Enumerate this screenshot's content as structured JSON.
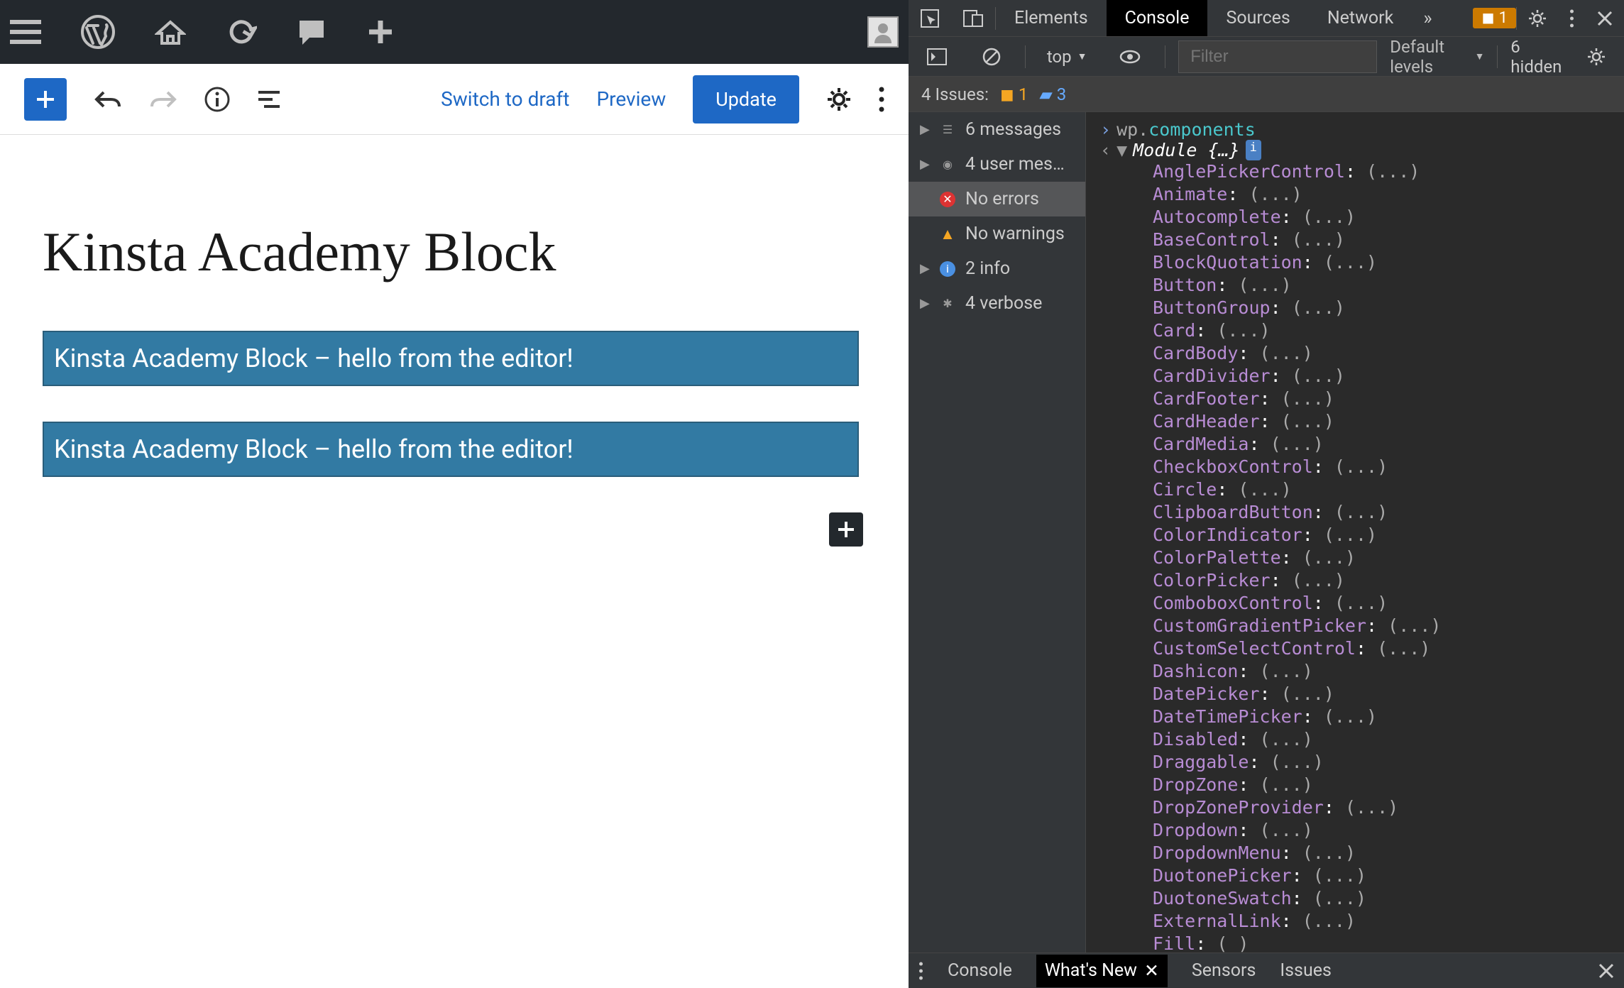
{
  "wp": {
    "avatar": "user"
  },
  "editor": {
    "switch_to_draft": "Switch to draft",
    "preview": "Preview",
    "update": "Update",
    "post_title": "Kinsta Academy Block",
    "block1": "Kinsta Academy Block – hello from the editor!",
    "block2": "Kinsta Academy Block – hello from the editor!"
  },
  "devtools": {
    "tabs": {
      "elements": "Elements",
      "console": "Console",
      "sources": "Sources",
      "network": "Network"
    },
    "issues_chip": "1",
    "ctx": "top",
    "filter_placeholder": "Filter",
    "levels": "Default levels",
    "hidden": "6 hidden",
    "issues_label": "4 Issues:",
    "issues_warn": "1",
    "issues_info": "3",
    "sidebar": {
      "messages": "6 messages",
      "user": "4 user mes…",
      "errors": "No errors",
      "warnings": "No warnings",
      "info": "2 info",
      "verbose": "4 verbose"
    },
    "console": {
      "input": "wp.components",
      "output_head": "Module {…}",
      "props": [
        "AnglePickerControl",
        "Animate",
        "Autocomplete",
        "BaseControl",
        "BlockQuotation",
        "Button",
        "ButtonGroup",
        "Card",
        "CardBody",
        "CardDivider",
        "CardFooter",
        "CardHeader",
        "CardMedia",
        "CheckboxControl",
        "Circle",
        "ClipboardButton",
        "ColorIndicator",
        "ColorPalette",
        "ColorPicker",
        "ComboboxControl",
        "CustomGradientPicker",
        "CustomSelectControl",
        "Dashicon",
        "DatePicker",
        "DateTimePicker",
        "Disabled",
        "Draggable",
        "DropZone",
        "DropZoneProvider",
        "Dropdown",
        "DropdownMenu",
        "DuotonePicker",
        "DuotoneSwatch",
        "ExternalLink",
        "Fill"
      ]
    },
    "drawer": {
      "console": "Console",
      "whats_new": "What's New",
      "sensors": "Sensors",
      "issues": "Issues"
    }
  }
}
